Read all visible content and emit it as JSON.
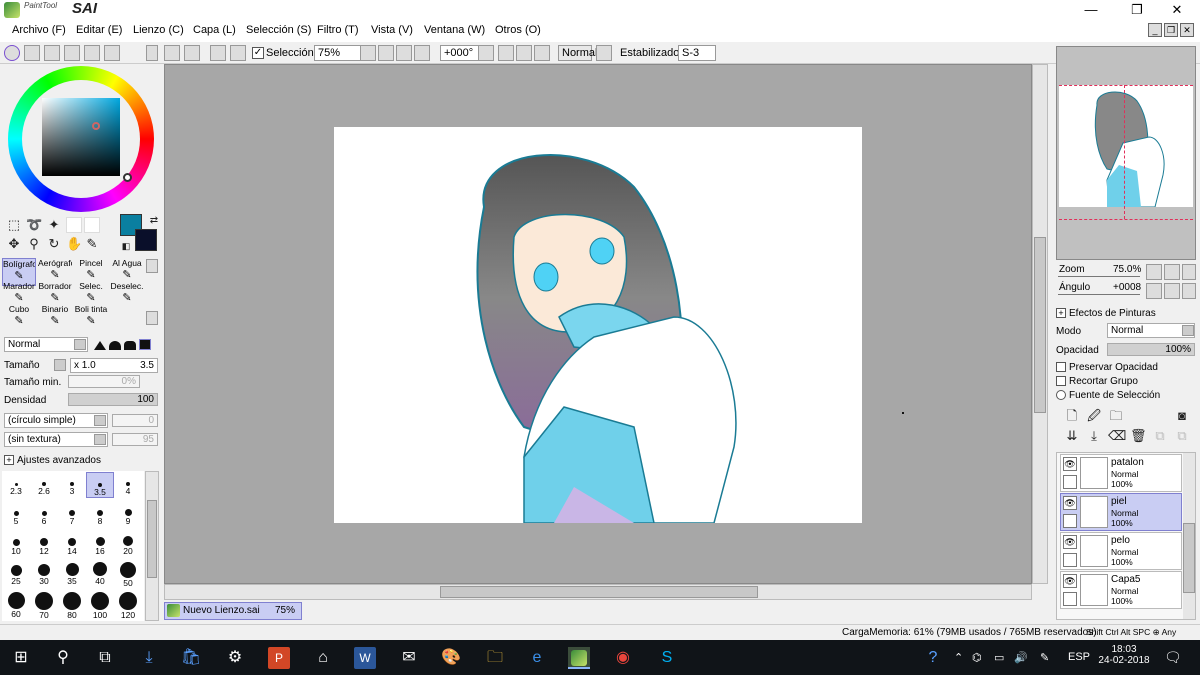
{
  "app": {
    "logo_text": "SAI",
    "brand": "PaintTool"
  },
  "window": {
    "minimize": "—",
    "maximize": "❐",
    "close": "✕"
  },
  "menu": [
    "Archivo (F)",
    "Editar (E)",
    "Lienzo (C)",
    "Capa (L)",
    "Selección (S)",
    "Filtro (T)",
    "Vista (V)",
    "Ventana (W)",
    "Otros (O)"
  ],
  "toolbar": {
    "selection_label": "Selección",
    "selection_checked": true,
    "zoom": "75%",
    "angle": "+000°",
    "blend": "Normal",
    "stabilizer_label": "Estabilizador",
    "stabilizer": "S-3"
  },
  "brushes": [
    {
      "name": "Bolígrafo",
      "selected": true
    },
    {
      "name": "Aerógrafo",
      "selected": false
    },
    {
      "name": "Pincel",
      "selected": false
    },
    {
      "name": "Al Agua",
      "selected": false
    },
    {
      "name": "Marador",
      "selected": false
    },
    {
      "name": "Borrador",
      "selected": false
    },
    {
      "name": "Selec.",
      "selected": false
    },
    {
      "name": "Deselec.",
      "selected": false
    },
    {
      "name": "Cubo",
      "selected": false
    },
    {
      "name": "Binario",
      "selected": false
    },
    {
      "name": "Boli tinta",
      "selected": false
    }
  ],
  "brush_settings": {
    "mode": "Normal",
    "size_label": "Tamaño",
    "size_mult": "x 1.0",
    "size_value": "3.5",
    "min_size_label": "Tamaño min.",
    "min_size_value": "0%",
    "density_label": "Densidad",
    "density_value": "100",
    "shape": "(círculo simple)",
    "shape_value": "0",
    "texture": "(sin textura)",
    "texture_value": "95",
    "advanced_label": "Ajustes avanzados"
  },
  "brush_sizes": [
    "2.3",
    "2.6",
    "3",
    "3.5",
    "4",
    "5",
    "6",
    "7",
    "8",
    "9",
    "10",
    "12",
    "14",
    "16",
    "20",
    "25",
    "30",
    "35",
    "40",
    "50",
    "60",
    "70",
    "80",
    "100",
    "120"
  ],
  "brush_size_selected": "3.5",
  "document_tab": {
    "name": "Nuevo Lienzo.sai",
    "zoom": "75%"
  },
  "navigator": {
    "zoom_label": "Zoom",
    "zoom_value": "75.0%",
    "angle_label": "Ángulo",
    "angle_value": "+0008"
  },
  "layer_props": {
    "effects_label": "Efectos de Pinturas",
    "mode_label": "Modo",
    "mode_value": "Normal",
    "opacity_label": "Opacidad",
    "opacity_value": "100%",
    "preserve_label": "Preservar Opacidad",
    "clip_label": "Recortar Grupo",
    "source_label": "Fuente de Selección"
  },
  "layers": [
    {
      "name": "patalon",
      "mode": "Normal",
      "opacity": "100%",
      "selected": false
    },
    {
      "name": "piel",
      "mode": "Normal",
      "opacity": "100%",
      "selected": true
    },
    {
      "name": "pelo",
      "mode": "Normal",
      "opacity": "100%",
      "selected": false
    },
    {
      "name": "Capa5",
      "mode": "Normal",
      "opacity": "100%",
      "selected": false
    }
  ],
  "status": {
    "memory": "CargaMemoria: 61% (79MB usados / 765MB reservados)",
    "keys": "Shift Ctrl Alt SPC ⊕ Any"
  },
  "taskbar": {
    "time": "18:03",
    "date": "24-02-2018",
    "lang": "ESP"
  },
  "colors": {
    "accent_selection": "#c9cdf3",
    "foreground": "#0a7fa0",
    "background": "#0a0f2a",
    "canvas_bg": "#a7a7a7"
  }
}
